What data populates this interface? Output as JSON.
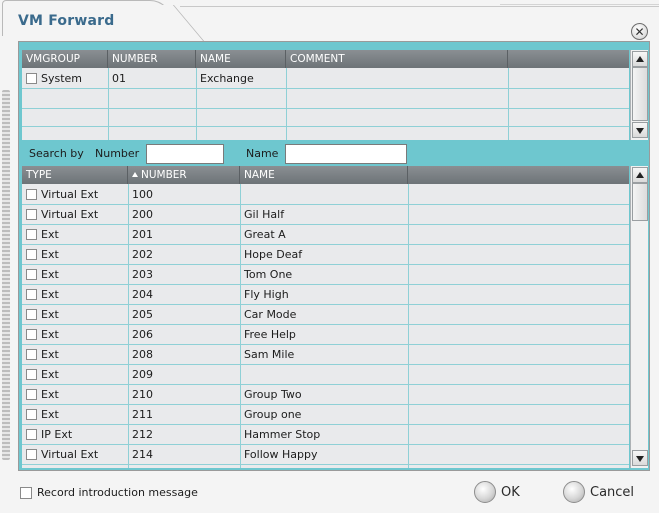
{
  "window": {
    "title": "VM Forward",
    "close_icon": "close-icon"
  },
  "vmgroup_grid": {
    "columns": [
      "VMGROUP",
      "NUMBER",
      "NAME",
      "COMMENT"
    ],
    "rows": [
      {
        "vmgroup": "System",
        "number": "01",
        "name": "Exchange",
        "comment": ""
      }
    ]
  },
  "search": {
    "label": "Search by",
    "number_label": "Number",
    "name_label": "Name",
    "number_value": "",
    "name_value": ""
  },
  "ext_grid": {
    "columns": [
      "TYPE",
      "NUMBER",
      "NAME"
    ],
    "rows": [
      {
        "type": "Virtual Ext",
        "number": "100",
        "name": ""
      },
      {
        "type": "Virtual Ext",
        "number": "200",
        "name": "Gil Half"
      },
      {
        "type": "Ext",
        "number": "201",
        "name": "Great A"
      },
      {
        "type": "Ext",
        "number": "202",
        "name": "Hope Deaf"
      },
      {
        "type": "Ext",
        "number": "203",
        "name": "Tom One"
      },
      {
        "type": "Ext",
        "number": "204",
        "name": "Fly High"
      },
      {
        "type": "Ext",
        "number": "205",
        "name": "Car  Mode"
      },
      {
        "type": "Ext",
        "number": "206",
        "name": "Free Help"
      },
      {
        "type": "Ext",
        "number": "208",
        "name": "Sam Mile"
      },
      {
        "type": "Ext",
        "number": "209",
        "name": ""
      },
      {
        "type": "Ext",
        "number": "210",
        "name": "Group Two"
      },
      {
        "type": "Ext",
        "number": "211",
        "name": "Group one"
      },
      {
        "type": "IP Ext",
        "number": "212",
        "name": "Hammer Stop"
      },
      {
        "type": "Virtual Ext",
        "number": "214",
        "name": "Follow Happy"
      }
    ]
  },
  "footer": {
    "record_label": "Record introduction message",
    "ok_label": "OK",
    "cancel_label": "Cancel"
  },
  "colors": {
    "accent": "#6ec7cf",
    "header": "#7a8085",
    "title": "#3a6a8c"
  }
}
